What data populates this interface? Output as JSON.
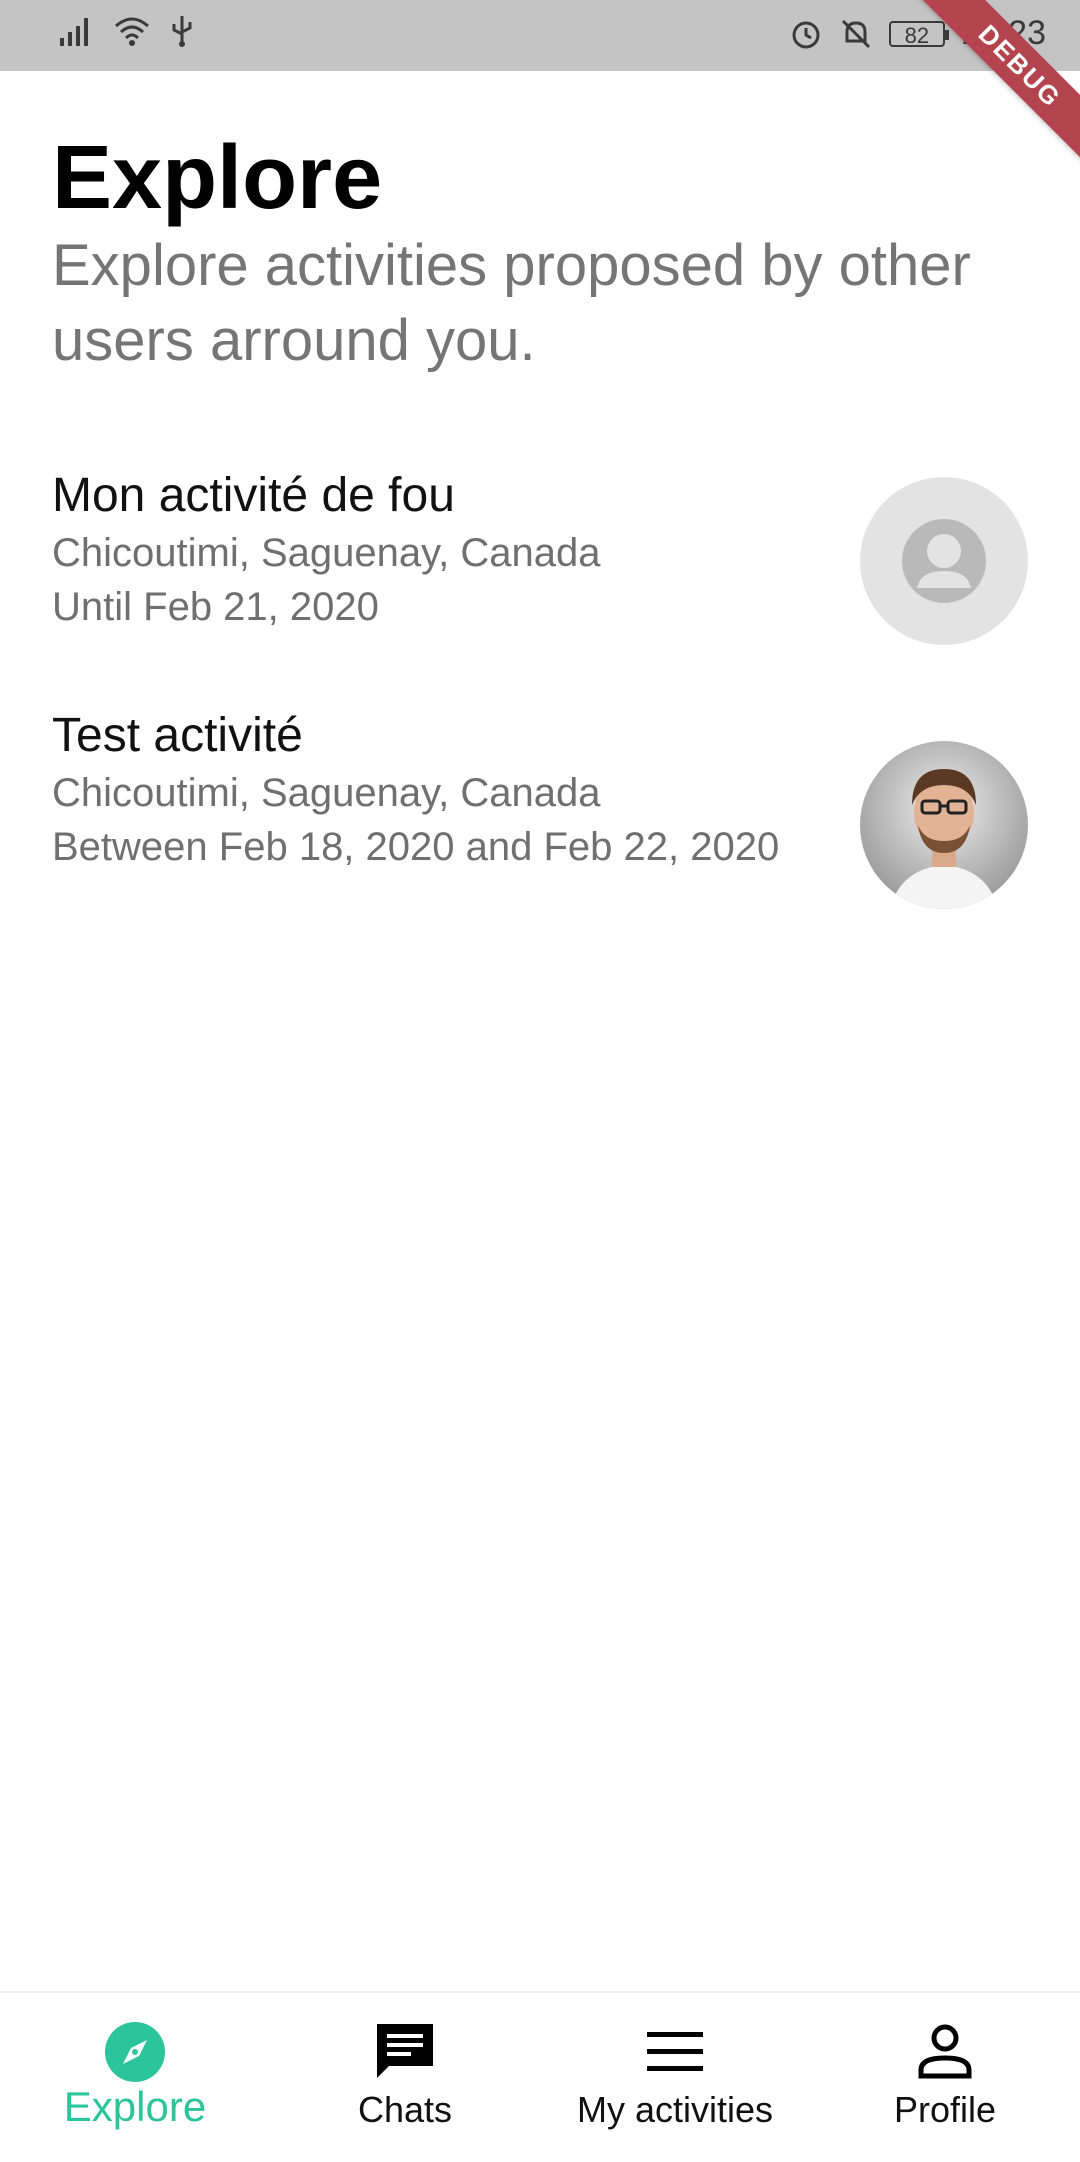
{
  "status_bar": {
    "time": "18:23",
    "battery": "82"
  },
  "debug_banner": "DEBUG",
  "header": {
    "title": "Explore",
    "subtitle": "Explore activities proposed by other users arround you."
  },
  "activities": [
    {
      "title": "Mon activité de fou",
      "location": "Chicoutimi, Saguenay, Canada",
      "dates": "Until Feb 21, 2020",
      "avatar": "default-avatar"
    },
    {
      "title": "Test activité",
      "location": "Chicoutimi, Saguenay, Canada",
      "dates": "Between Feb 18, 2020 and Feb 22, 2020",
      "avatar": "user-photo"
    }
  ],
  "bottom_nav": {
    "items": [
      {
        "label": "Explore",
        "icon": "compass-icon",
        "active": true
      },
      {
        "label": "Chats",
        "icon": "chat-icon",
        "active": false
      },
      {
        "label": "My activities",
        "icon": "menu-icon",
        "active": false
      },
      {
        "label": "Profile",
        "icon": "person-icon",
        "active": false
      }
    ]
  },
  "colors": {
    "accent": "#2cc49b",
    "status_bar": "#c4c4c4",
    "debug_ribbon": "#b3434c",
    "secondary_text": "#757575"
  }
}
